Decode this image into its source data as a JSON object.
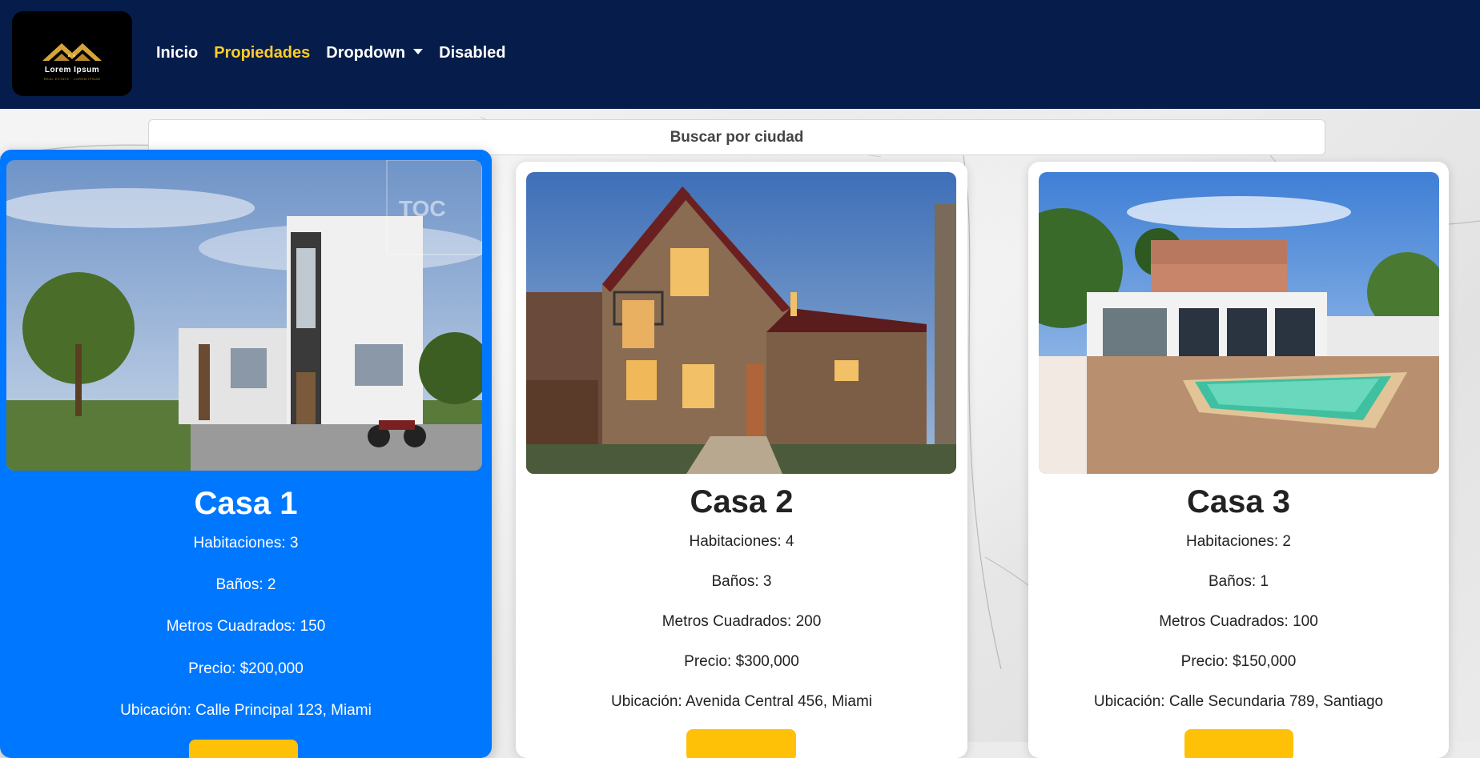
{
  "brand": {
    "name": "Lorem Ipsum",
    "tagline": "REAL ESTATE · LOREM IPSUM"
  },
  "nav": {
    "items": [
      {
        "label": "Inicio",
        "active": false
      },
      {
        "label": "Propiedades",
        "active": true
      },
      {
        "label": "Dropdown",
        "active": false,
        "dropdown": true
      },
      {
        "label": "Disabled",
        "active": false
      }
    ]
  },
  "search": {
    "label": "Buscar por ciudad"
  },
  "colors": {
    "navbar": "#061c4a",
    "accent": "#ffcc29",
    "featured_card": "#0077ff",
    "button": "#ffc107"
  },
  "properties": [
    {
      "title": "Casa 1",
      "rooms": "Habitaciones: 3",
      "baths": "Baños: 2",
      "area": "Metros Cuadrados: 150",
      "price": "Precio: $200,000",
      "location": "Ubicación: Calle Principal 123, Miami",
      "image": "modern-white-house-photo",
      "watermark": "TOC"
    },
    {
      "title": "Casa 2",
      "rooms": "Habitaciones: 4",
      "baths": "Baños: 3",
      "area": "Metros Cuadrados: 200",
      "price": "Precio: $300,000",
      "location": "Ubicación: Avenida Central 456, Miami",
      "image": "two-story-brown-house-photo"
    },
    {
      "title": "Casa 3",
      "rooms": "Habitaciones: 2",
      "baths": "Baños: 1",
      "area": "Metros Cuadrados: 100",
      "price": "Precio: $150,000",
      "location": "Ubicación: Calle Secundaria 789, Santiago",
      "image": "house-with-pool-photo"
    }
  ]
}
